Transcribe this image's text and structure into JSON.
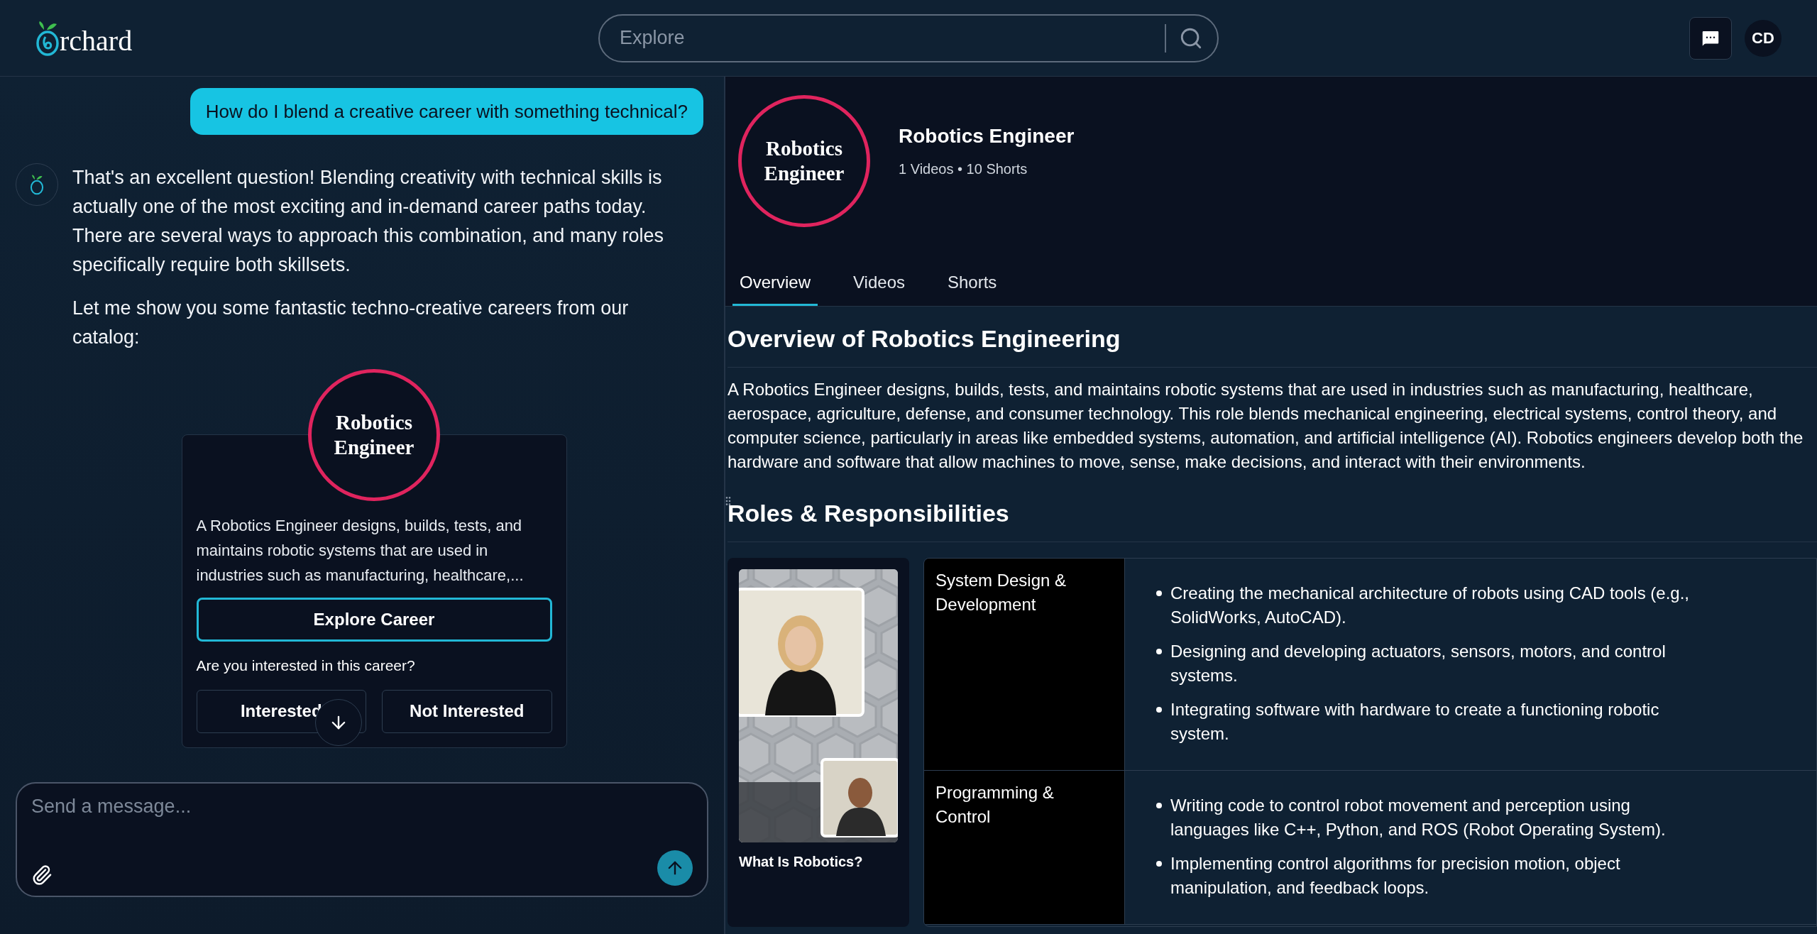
{
  "header": {
    "logo_text": "rchard",
    "search": {
      "placeholder": "Explore"
    },
    "avatar": "CD"
  },
  "chat": {
    "user_message": "How do I blend a creative career with something technical?",
    "assistant_paragraphs": [
      "That's an excellent question! Blending creativity with technical skills is actually one of the most exciting and in-demand career paths today. There are several ways to approach this combination, and many roles specifically require both skillsets.",
      "Let me show you some fantastic techno-creative careers from our catalog:"
    ],
    "career_card": {
      "badge": "Robotics Engineer",
      "description": "A Robotics Engineer designs, builds, tests, and maintains robotic systems that are used in industries such as manufacturing, healthcare,...",
      "primary_button": "Explore Career",
      "question": "Are you interested in this career?",
      "buttons": [
        "Interested",
        "Not Interested"
      ]
    },
    "composer": {
      "placeholder": "Send a message..."
    }
  },
  "career": {
    "badge": "Robotics Engineer",
    "name": "Robotics Engineer",
    "stats": "1 Videos • 10 Shorts",
    "tabs": [
      {
        "label": "Overview",
        "selected": true
      },
      {
        "label": "Videos",
        "selected": false
      },
      {
        "label": "Shorts",
        "selected": false
      }
    ],
    "overview": {
      "heading": "Overview of Robotics Engineering",
      "text": "A Robotics Engineer designs, builds, tests, and maintains robotic systems that are used in industries such as manufacturing, healthcare, aerospace, agriculture, defense, and consumer technology. This role blends mechanical engineering, electrical systems, control theory, and computer science, particularly in areas like embedded systems, automation, and artificial intelligence (AI). Robotics engineers develop both the hardware and software that allow machines to move, sense, make decisions, and interact with their environments."
    },
    "roles": {
      "heading": "Roles & Responsibilities",
      "video": {
        "kind": "picture",
        "title": "What Is Robotics?"
      },
      "rows": [
        {
          "title": "System Design & Development",
          "bullets": [
            "Creating the mechanical architecture of robots using CAD tools (e.g., SolidWorks, AutoCAD).",
            "Designing and developing actuators, sensors, motors, and control systems.",
            "Integrating software with hardware to create a functioning robotic system."
          ]
        },
        {
          "title": "Programming & Control",
          "bullets": [
            "Writing code to control robot movement and perception using languages like C++, Python, and ROS (Robot Operating System).",
            "Implementing control algorithms for precision motion, object manipulation, and feedback loops."
          ]
        }
      ]
    }
  }
}
